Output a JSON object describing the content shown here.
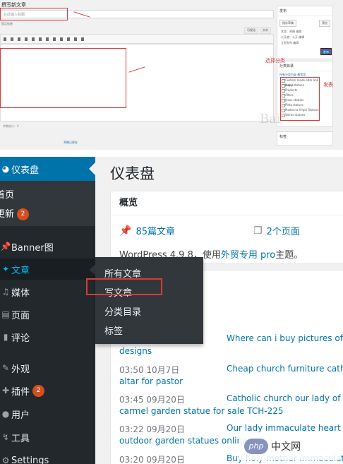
{
  "editor": {
    "page_title": "撰写新文章",
    "title_placeholder": "在此输入标题",
    "permalink": "固定链接",
    "tabs": [
      "可视化",
      "文本"
    ],
    "word_count": "字数统计：0",
    "draft_note": "草稿已保存",
    "publish_box": {
      "title": "发布",
      "save_draft": "保存草稿",
      "preview": "预览",
      "status": "状态：草稿 编辑",
      "visibility": "公开度：公开 编辑",
      "schedule": "立即发布 编辑",
      "publish_button": "发布"
    },
    "category_box": {
      "title": "分类目录",
      "tabs": "所有分类目录  最常用",
      "items": [
        "Custom made altar and pulpit",
        "Many statues",
        "Products",
        "Altars",
        "Jesus statues",
        "Pieta statues",
        "Madonna Virgin Statues",
        "Saints statues"
      ]
    },
    "tag_box": {
      "title": "标签"
    },
    "annotations": {
      "choose_category": "选择分类",
      "publish": "发表"
    }
  },
  "sidebar": {
    "dashboard": {
      "label": "仪表盘",
      "icon": "dashboard-icon"
    },
    "home": "首页",
    "updates": {
      "label": "更新",
      "count": "2"
    },
    "items": [
      {
        "label": "Banner图",
        "icon": "pushpin-icon"
      },
      {
        "label": "文章",
        "icon": "pushpin-icon"
      },
      {
        "label": "媒体",
        "icon": "media-icon"
      },
      {
        "label": "页面",
        "icon": "page-icon"
      },
      {
        "label": "评论",
        "icon": "comment-icon"
      },
      {
        "label": "外观",
        "icon": "brush-icon"
      },
      {
        "label": "插件",
        "icon": "plugin-icon",
        "count": "2"
      },
      {
        "label": "用户",
        "icon": "user-icon"
      },
      {
        "label": "工具",
        "icon": "wrench-icon"
      },
      {
        "label": "Settings",
        "icon": "settings-icon"
      }
    ]
  },
  "flyout": {
    "items": [
      "所有文章",
      "写文章",
      "分类目录",
      "标签"
    ]
  },
  "main": {
    "title": "仪表盘",
    "overview": {
      "heading": "概览",
      "posts": "85篇文章",
      "pages": "2个页面",
      "version_prefix": "WordPress 4.9.8，使用",
      "theme_link": "外贸专用 pro",
      "version_suffix": "主题。"
    },
    "activity": {
      "posts": [
        {
          "time": "",
          "title": "Where can i buy pictures of",
          "cont": "designs"
        },
        {
          "time": "03:50 10月7日",
          "title": "Cheap church furniture catho",
          "cont": "altar for pastor"
        },
        {
          "time": "03:45 09月20日",
          "title": "Catholic church our lady of m",
          "cont": "carmel garden statue for sale TCH-225"
        },
        {
          "time": "03:22 09月20日",
          "title": "Our lady immaculate heart of",
          "cont": "outdoor garden statues online"
        },
        {
          "time": "03:20 09月20日",
          "title": "Buy holy mother immaculate",
          "cont": ""
        }
      ]
    }
  },
  "watermark": {
    "logo": "php",
    "text": "中文网"
  },
  "watermark_top": "Bai"
}
